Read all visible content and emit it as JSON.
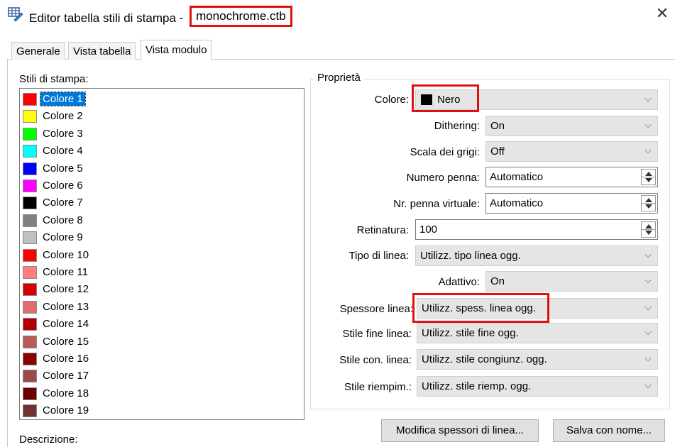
{
  "window": {
    "title": "Editor tabella stili di stampa -",
    "file_name": "monochrome.ctb",
    "close_glyph": "✕"
  },
  "tabs": [
    {
      "label": "Generale"
    },
    {
      "label": "Vista tabella"
    },
    {
      "label": "Vista modulo",
      "active": true
    }
  ],
  "styles_list": {
    "caption": "Stili di stampa:",
    "items": [
      {
        "label": "Colore 1",
        "color": "#ff0000"
      },
      {
        "label": "Colore 2",
        "color": "#ffff00"
      },
      {
        "label": "Colore 3",
        "color": "#00ff00"
      },
      {
        "label": "Colore 4",
        "color": "#00ffff"
      },
      {
        "label": "Colore 5",
        "color": "#0000ff"
      },
      {
        "label": "Colore 6",
        "color": "#ff00ff"
      },
      {
        "label": "Colore 7",
        "color": "#000000"
      },
      {
        "label": "Colore 8",
        "color": "#808080"
      },
      {
        "label": "Colore 9",
        "color": "#c0c0c0"
      },
      {
        "label": "Colore 10",
        "color": "#ff0000"
      },
      {
        "label": "Colore 11",
        "color": "#ff7f7f"
      },
      {
        "label": "Colore 12",
        "color": "#d40000"
      },
      {
        "label": "Colore 13",
        "color": "#e06c6c"
      },
      {
        "label": "Colore 14",
        "color": "#b30000"
      },
      {
        "label": "Colore 15",
        "color": "#b85a5a"
      },
      {
        "label": "Colore 16",
        "color": "#8b0000"
      },
      {
        "label": "Colore 17",
        "color": "#9c4a4a"
      },
      {
        "label": "Colore 18",
        "color": "#6b0000"
      },
      {
        "label": "Colore 19",
        "color": "#6e3434"
      }
    ],
    "selected_label": "Colore 1"
  },
  "description": {
    "label": "Descrizione:"
  },
  "properties": {
    "group_title": "Proprietà",
    "colore": {
      "label": "Colore:",
      "value": "Nero",
      "swatch": "#000000"
    },
    "dithering": {
      "label": "Dithering:",
      "value": "On"
    },
    "scala_grigi": {
      "label": "Scala dei grigi:",
      "value": "Off"
    },
    "numero_penna": {
      "label": "Numero penna:",
      "value": "Automatico"
    },
    "penna_virtuale": {
      "label": "Nr. penna virtuale:",
      "value": "Automatico"
    },
    "retinatura": {
      "label": "Retinatura:",
      "value": "100"
    },
    "tipo_linea": {
      "label": "Tipo di linea:",
      "value": "Utilizz. tipo linea ogg."
    },
    "adattivo": {
      "label": "Adattivo:",
      "value": "On"
    },
    "spessore_linea": {
      "label": "Spessore linea:",
      "value": "Utilizz. spess. linea ogg."
    },
    "stile_fine_linea": {
      "label": "Stile fine linea:",
      "value": "Utilizz. stile fine ogg."
    },
    "stile_con_linea": {
      "label": "Stile con. linea:",
      "value": "Utilizz. stile congiunz. ogg."
    },
    "stile_riempim": {
      "label": "Stile riempim.:",
      "value": "Utilizz. stile riemp. ogg."
    }
  },
  "buttons": {
    "edit_lineweights": "Modifica spessori di linea...",
    "save_as": "Salva con nome..."
  },
  "icons": {
    "chevron_down": "⌵",
    "scroll_up": "⌃",
    "scroll_down": "⌄"
  },
  "colors": {
    "highlight": "#e01010",
    "selection": "#0078d7"
  }
}
